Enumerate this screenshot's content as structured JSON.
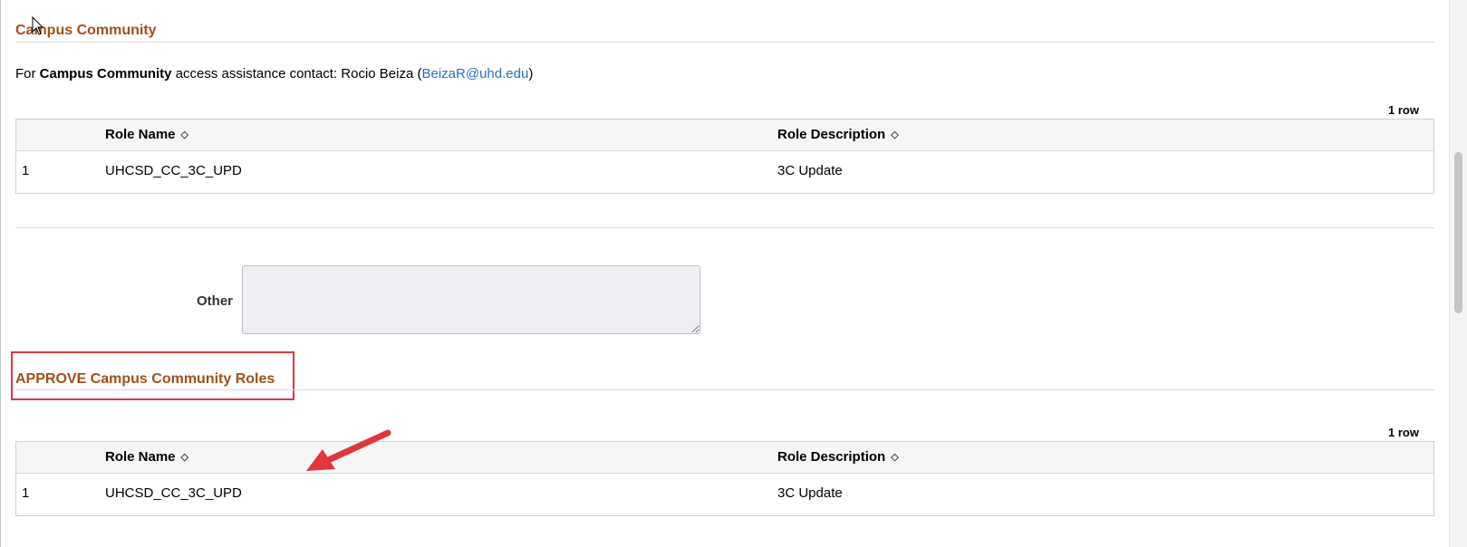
{
  "section1": {
    "title": "Campus Community",
    "contact_prefix": "For ",
    "contact_bold": "Campus Community",
    "contact_mid": " access assistance contact: Rocio Beiza  (",
    "contact_email": "BeizaR@uhd.edu",
    "contact_suffix": ")",
    "row_count": "1 row",
    "grid": {
      "headers": [
        "Role Name",
        "Role Description"
      ],
      "rows": [
        {
          "num": "1",
          "role_name": "UHCSD_CC_3C_UPD",
          "role_description": "3C Update"
        }
      ]
    }
  },
  "other": {
    "label": "Other",
    "value": ""
  },
  "section2": {
    "title": "APPROVE Campus Community Roles",
    "row_count": "1 row",
    "grid": {
      "headers": [
        "Role Name",
        "Role Description"
      ],
      "rows": [
        {
          "num": "1",
          "role_name": "UHCSD_CC_3C_UPD",
          "role_description": "3C Update"
        }
      ]
    }
  },
  "icons": {
    "sort": "sort-icon",
    "cursor": "cursor-icon",
    "annotation": "red-arrow-icon"
  },
  "colors": {
    "section_title": "#a0501b",
    "link": "#2a6fc5",
    "annotation": "#e0373c"
  }
}
